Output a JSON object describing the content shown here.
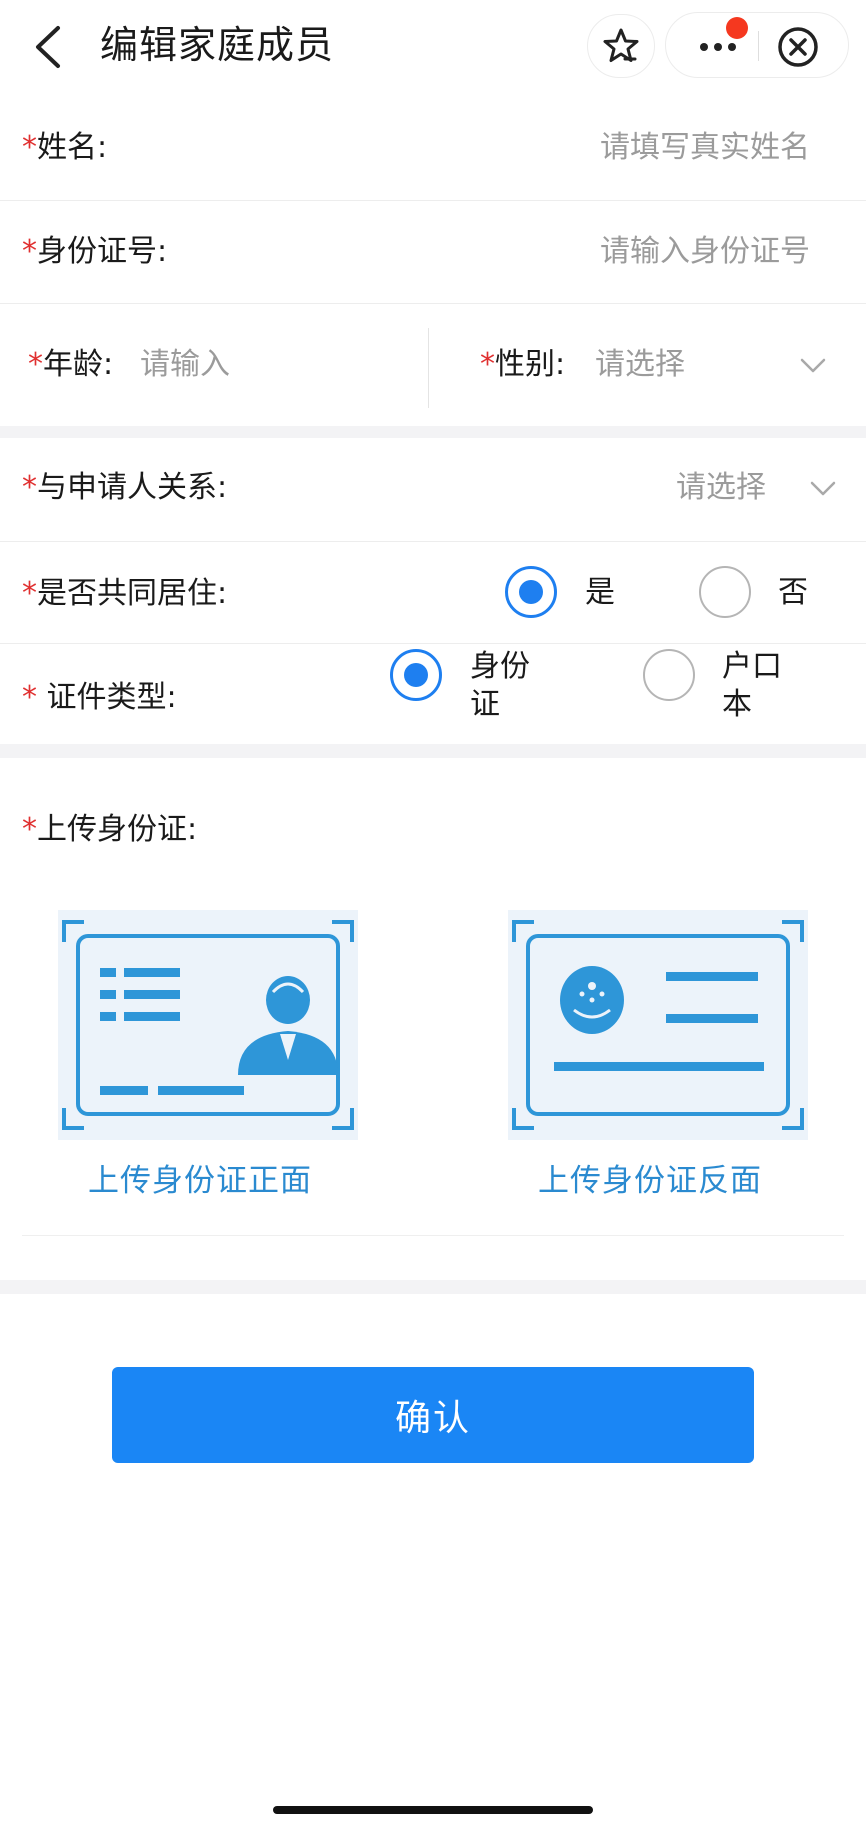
{
  "header": {
    "title": "编辑家庭成员",
    "back_icon": "chevron-left-icon",
    "favorite_icon": "star-icon",
    "more_icon": "more-dots-icon",
    "close_icon": "close-circle-icon",
    "notification_dot_color": "#f5381f"
  },
  "form": {
    "required_mark": "*",
    "name": {
      "label": "姓名:",
      "placeholder": "请填写真实姓名"
    },
    "id_number": {
      "label": "身份证号:",
      "placeholder": "请输入身份证号"
    },
    "age": {
      "label": "年龄:",
      "placeholder": "请输入"
    },
    "gender": {
      "label": "性别:",
      "placeholder": "请选择"
    },
    "relation": {
      "label": "与申请人关系:",
      "placeholder": "请选择"
    },
    "cohabit": {
      "label": "是否共同居住:",
      "options": [
        {
          "label": "是",
          "selected": true
        },
        {
          "label": "否",
          "selected": false
        }
      ]
    },
    "cert_type": {
      "label": " 证件类型:",
      "options": [
        {
          "line1": "身份",
          "line2": "证",
          "selected": true
        },
        {
          "line1": "户口",
          "line2": "本",
          "selected": false
        }
      ]
    },
    "upload": {
      "label": "上传身份证:",
      "front_caption": "上传身份证正面",
      "back_caption": "上传身份证反面"
    }
  },
  "confirm_label": "确认",
  "colors": {
    "accent": "#1a86f5",
    "required": "#e03030",
    "upload_caption": "#2a8ad0",
    "card_icon": "#2e96d8"
  }
}
